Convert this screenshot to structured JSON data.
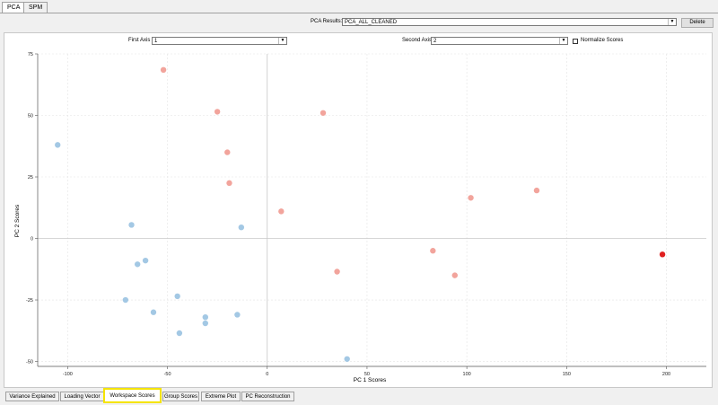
{
  "top_tabs": [
    {
      "label": "PCA"
    },
    {
      "label": "SPM"
    }
  ],
  "pca_results": {
    "label": "PCA Results:",
    "value": "PCA_ALL_CLEANED",
    "delete_label": "Delete"
  },
  "axes_controls": {
    "first_axis_label": "First Axis",
    "first_axis_value": "1",
    "second_axis_label": "Second Axis",
    "second_axis_value": "2",
    "normalize_label": "Normalize Scores"
  },
  "colors": {
    "group_a": "#a3c8e4",
    "group_b": "#f2a49c",
    "highlight": "#e02020"
  },
  "chart_data": {
    "type": "scatter",
    "xlabel": "PC 1 Scores",
    "ylabel": "PC 2 Scores",
    "xlim": [
      -115,
      220
    ],
    "ylim": [
      -52,
      75
    ],
    "xticks": [
      -100,
      -50,
      0,
      50,
      100,
      150,
      200
    ],
    "yticks": [
      -50,
      -25,
      0,
      25,
      50,
      75
    ],
    "grid": true,
    "series": [
      {
        "color_key": "group_a",
        "points": [
          {
            "x": -105,
            "y": 38
          },
          {
            "x": -68,
            "y": 5.5
          },
          {
            "x": -13,
            "y": 4.5
          },
          {
            "x": -65,
            "y": -10.5
          },
          {
            "x": -61,
            "y": -9
          },
          {
            "x": -71,
            "y": -25
          },
          {
            "x": -45,
            "y": -23.5
          },
          {
            "x": -57,
            "y": -30
          },
          {
            "x": -31,
            "y": -32
          },
          {
            "x": -31,
            "y": -34.5
          },
          {
            "x": -15,
            "y": -31
          },
          {
            "x": -44,
            "y": -38.5
          },
          {
            "x": 40,
            "y": -49
          }
        ]
      },
      {
        "color_key": "group_b",
        "points": [
          {
            "x": -52,
            "y": 68.5
          },
          {
            "x": -25,
            "y": 51.5
          },
          {
            "x": 28,
            "y": 51
          },
          {
            "x": -20,
            "y": 35
          },
          {
            "x": -19,
            "y": 22.5
          },
          {
            "x": 7,
            "y": 11
          },
          {
            "x": 102,
            "y": 16.5
          },
          {
            "x": 135,
            "y": 19.5
          },
          {
            "x": 83,
            "y": -5
          },
          {
            "x": 35,
            "y": -13.5
          },
          {
            "x": 94,
            "y": -15
          }
        ]
      },
      {
        "color_key": "highlight",
        "points": [
          {
            "x": 198,
            "y": -6.5
          }
        ]
      }
    ]
  },
  "bottom_tabs": [
    {
      "label": "Variance Explained"
    },
    {
      "label": "Loading Vector"
    },
    {
      "label": "Workspace Scores"
    },
    {
      "label": "Group Scores"
    },
    {
      "label": "Extreme Plot"
    },
    {
      "label": "PC Reconstruction"
    }
  ]
}
